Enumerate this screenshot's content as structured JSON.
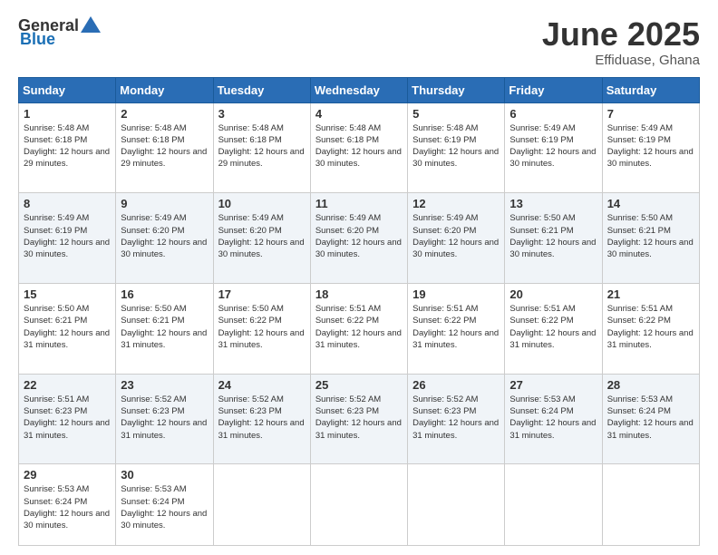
{
  "header": {
    "logo_general": "General",
    "logo_blue": "Blue",
    "title": "June 2025",
    "location": "Effiduase, Ghana"
  },
  "days_header": [
    "Sunday",
    "Monday",
    "Tuesday",
    "Wednesday",
    "Thursday",
    "Friday",
    "Saturday"
  ],
  "weeks": [
    {
      "shaded": false,
      "cells": [
        {
          "day": "1",
          "sunrise": "Sunrise: 5:48 AM",
          "sunset": "Sunset: 6:18 PM",
          "daylight": "Daylight: 12 hours and 29 minutes."
        },
        {
          "day": "2",
          "sunrise": "Sunrise: 5:48 AM",
          "sunset": "Sunset: 6:18 PM",
          "daylight": "Daylight: 12 hours and 29 minutes."
        },
        {
          "day": "3",
          "sunrise": "Sunrise: 5:48 AM",
          "sunset": "Sunset: 6:18 PM",
          "daylight": "Daylight: 12 hours and 29 minutes."
        },
        {
          "day": "4",
          "sunrise": "Sunrise: 5:48 AM",
          "sunset": "Sunset: 6:18 PM",
          "daylight": "Daylight: 12 hours and 30 minutes."
        },
        {
          "day": "5",
          "sunrise": "Sunrise: 5:48 AM",
          "sunset": "Sunset: 6:19 PM",
          "daylight": "Daylight: 12 hours and 30 minutes."
        },
        {
          "day": "6",
          "sunrise": "Sunrise: 5:49 AM",
          "sunset": "Sunset: 6:19 PM",
          "daylight": "Daylight: 12 hours and 30 minutes."
        },
        {
          "day": "7",
          "sunrise": "Sunrise: 5:49 AM",
          "sunset": "Sunset: 6:19 PM",
          "daylight": "Daylight: 12 hours and 30 minutes."
        }
      ]
    },
    {
      "shaded": true,
      "cells": [
        {
          "day": "8",
          "sunrise": "Sunrise: 5:49 AM",
          "sunset": "Sunset: 6:19 PM",
          "daylight": "Daylight: 12 hours and 30 minutes."
        },
        {
          "day": "9",
          "sunrise": "Sunrise: 5:49 AM",
          "sunset": "Sunset: 6:20 PM",
          "daylight": "Daylight: 12 hours and 30 minutes."
        },
        {
          "day": "10",
          "sunrise": "Sunrise: 5:49 AM",
          "sunset": "Sunset: 6:20 PM",
          "daylight": "Daylight: 12 hours and 30 minutes."
        },
        {
          "day": "11",
          "sunrise": "Sunrise: 5:49 AM",
          "sunset": "Sunset: 6:20 PM",
          "daylight": "Daylight: 12 hours and 30 minutes."
        },
        {
          "day": "12",
          "sunrise": "Sunrise: 5:49 AM",
          "sunset": "Sunset: 6:20 PM",
          "daylight": "Daylight: 12 hours and 30 minutes."
        },
        {
          "day": "13",
          "sunrise": "Sunrise: 5:50 AM",
          "sunset": "Sunset: 6:21 PM",
          "daylight": "Daylight: 12 hours and 30 minutes."
        },
        {
          "day": "14",
          "sunrise": "Sunrise: 5:50 AM",
          "sunset": "Sunset: 6:21 PM",
          "daylight": "Daylight: 12 hours and 30 minutes."
        }
      ]
    },
    {
      "shaded": false,
      "cells": [
        {
          "day": "15",
          "sunrise": "Sunrise: 5:50 AM",
          "sunset": "Sunset: 6:21 PM",
          "daylight": "Daylight: 12 hours and 31 minutes."
        },
        {
          "day": "16",
          "sunrise": "Sunrise: 5:50 AM",
          "sunset": "Sunset: 6:21 PM",
          "daylight": "Daylight: 12 hours and 31 minutes."
        },
        {
          "day": "17",
          "sunrise": "Sunrise: 5:50 AM",
          "sunset": "Sunset: 6:22 PM",
          "daylight": "Daylight: 12 hours and 31 minutes."
        },
        {
          "day": "18",
          "sunrise": "Sunrise: 5:51 AM",
          "sunset": "Sunset: 6:22 PM",
          "daylight": "Daylight: 12 hours and 31 minutes."
        },
        {
          "day": "19",
          "sunrise": "Sunrise: 5:51 AM",
          "sunset": "Sunset: 6:22 PM",
          "daylight": "Daylight: 12 hours and 31 minutes."
        },
        {
          "day": "20",
          "sunrise": "Sunrise: 5:51 AM",
          "sunset": "Sunset: 6:22 PM",
          "daylight": "Daylight: 12 hours and 31 minutes."
        },
        {
          "day": "21",
          "sunrise": "Sunrise: 5:51 AM",
          "sunset": "Sunset: 6:22 PM",
          "daylight": "Daylight: 12 hours and 31 minutes."
        }
      ]
    },
    {
      "shaded": true,
      "cells": [
        {
          "day": "22",
          "sunrise": "Sunrise: 5:51 AM",
          "sunset": "Sunset: 6:23 PM",
          "daylight": "Daylight: 12 hours and 31 minutes."
        },
        {
          "day": "23",
          "sunrise": "Sunrise: 5:52 AM",
          "sunset": "Sunset: 6:23 PM",
          "daylight": "Daylight: 12 hours and 31 minutes."
        },
        {
          "day": "24",
          "sunrise": "Sunrise: 5:52 AM",
          "sunset": "Sunset: 6:23 PM",
          "daylight": "Daylight: 12 hours and 31 minutes."
        },
        {
          "day": "25",
          "sunrise": "Sunrise: 5:52 AM",
          "sunset": "Sunset: 6:23 PM",
          "daylight": "Daylight: 12 hours and 31 minutes."
        },
        {
          "day": "26",
          "sunrise": "Sunrise: 5:52 AM",
          "sunset": "Sunset: 6:23 PM",
          "daylight": "Daylight: 12 hours and 31 minutes."
        },
        {
          "day": "27",
          "sunrise": "Sunrise: 5:53 AM",
          "sunset": "Sunset: 6:24 PM",
          "daylight": "Daylight: 12 hours and 31 minutes."
        },
        {
          "day": "28",
          "sunrise": "Sunrise: 5:53 AM",
          "sunset": "Sunset: 6:24 PM",
          "daylight": "Daylight: 12 hours and 31 minutes."
        }
      ]
    },
    {
      "shaded": false,
      "cells": [
        {
          "day": "29",
          "sunrise": "Sunrise: 5:53 AM",
          "sunset": "Sunset: 6:24 PM",
          "daylight": "Daylight: 12 hours and 30 minutes."
        },
        {
          "day": "30",
          "sunrise": "Sunrise: 5:53 AM",
          "sunset": "Sunset: 6:24 PM",
          "daylight": "Daylight: 12 hours and 30 minutes."
        },
        {
          "day": "",
          "sunrise": "",
          "sunset": "",
          "daylight": ""
        },
        {
          "day": "",
          "sunrise": "",
          "sunset": "",
          "daylight": ""
        },
        {
          "day": "",
          "sunrise": "",
          "sunset": "",
          "daylight": ""
        },
        {
          "day": "",
          "sunrise": "",
          "sunset": "",
          "daylight": ""
        },
        {
          "day": "",
          "sunrise": "",
          "sunset": "",
          "daylight": ""
        }
      ]
    }
  ]
}
